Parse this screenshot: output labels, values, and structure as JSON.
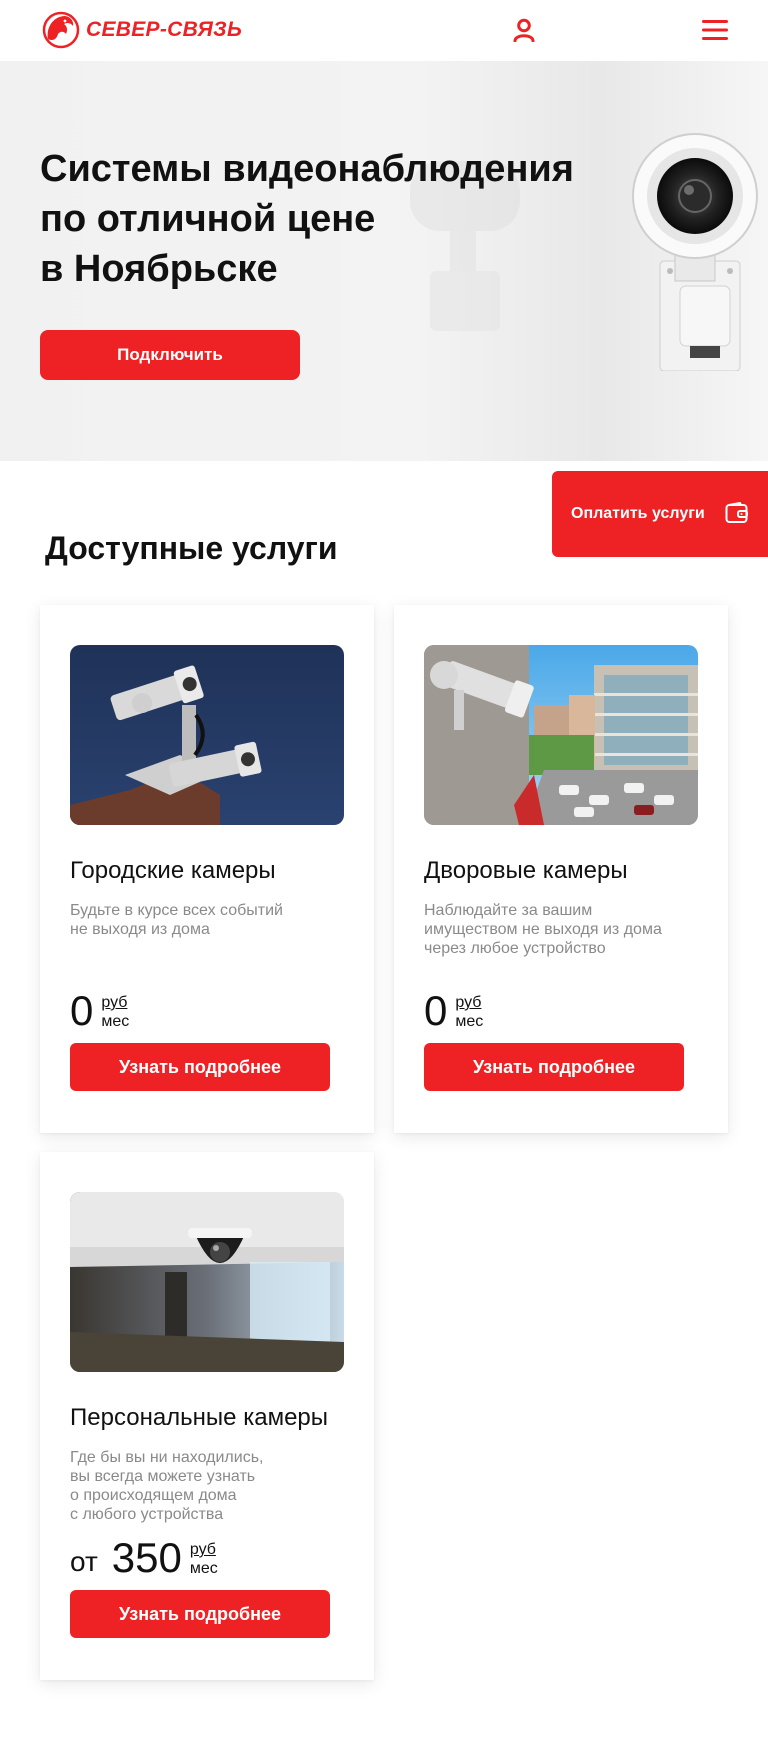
{
  "header": {
    "brand_name": "СЕВЕР-СВЯЗЬ",
    "logo_icon": "lion-head-logo",
    "user_icon": "user-icon",
    "menu_icon": "hamburger-menu-icon"
  },
  "hero": {
    "title_lines": [
      "Системы видеонаблюдения",
      "по отличной цене",
      "в Ноябрьске"
    ],
    "button_label": "Подключить",
    "image_icon": "security-camera"
  },
  "pay_tab": {
    "label": "Оплатить услуги",
    "icon": "wallet-icon"
  },
  "services": {
    "title": "Доступные услуги",
    "cards": [
      {
        "title": "Городские камеры",
        "description_lines": [
          "Будьте в курсе всех событий",
          "не выходя из дома"
        ],
        "price_prefix": "",
        "price": "0",
        "unit_top": "руб",
        "unit_bottom": "мес",
        "button_label": "Узнать подробнее"
      },
      {
        "title": "Дворовые камеры",
        "description_lines": [
          "Наблюдайте за вашим",
          "имуществом не выходя из дома",
          "через любое устройство"
        ],
        "price_prefix": "",
        "price": "0",
        "unit_top": "руб",
        "unit_bottom": "мес",
        "button_label": "Узнать подробнее"
      },
      {
        "title": "Персональные камеры",
        "description_lines": [
          "Где бы вы ни находились,",
          "вы всегда можете узнать",
          "о происходящем дома",
          "с любого устройства"
        ],
        "price_prefix": "от",
        "price": "350",
        "unit_top": "руб",
        "unit_bottom": "мес",
        "button_label": "Узнать подробнее"
      }
    ]
  },
  "colors": {
    "accent": "#ee2224",
    "text": "#111111",
    "muted": "#8a8a8a"
  }
}
